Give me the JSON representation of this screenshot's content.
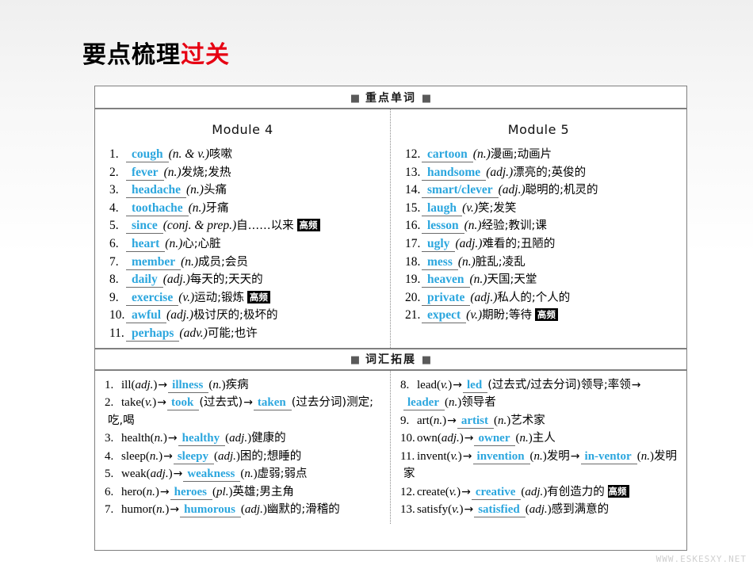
{
  "title": {
    "black": "要点梳理",
    "red": "过关",
    "red_color": "#e60012"
  },
  "accent_blue": "#2ba6de",
  "sections": {
    "key_words": {
      "band": "重点单词",
      "square": "■",
      "columns": [
        {
          "module": "Module 4",
          "items": [
            {
              "num": "1.",
              "word": "cough",
              "pos": "(n. & v.)",
              "meaning": "咳嗽",
              "badge": ""
            },
            {
              "num": "2.",
              "word": "fever",
              "pos": "(n.)",
              "meaning": "发烧;发热",
              "badge": ""
            },
            {
              "num": "3.",
              "word": "headache",
              "pos": "(n.)",
              "meaning": "头痛",
              "badge": ""
            },
            {
              "num": "4.",
              "word": "toothache",
              "pos": "(n.)",
              "meaning": "牙痛",
              "badge": ""
            },
            {
              "num": "5.",
              "word": "since",
              "pos": "(conj. & prep.)",
              "meaning": "自……以来",
              "badge": "高频"
            },
            {
              "num": "6.",
              "word": "heart",
              "pos": "(n.)",
              "meaning": "心;心脏",
              "badge": ""
            },
            {
              "num": "7.",
              "word": "member",
              "pos": "(n.)",
              "meaning": "成员;会员",
              "badge": ""
            },
            {
              "num": "8.",
              "word": "daily",
              "pos": "(adj.)",
              "meaning": "每天的;天天的",
              "badge": ""
            },
            {
              "num": "9.",
              "word": "exercise",
              "pos": "(v.)",
              "meaning": "运动;锻炼",
              "badge": "高频"
            },
            {
              "num": "10.",
              "word": "awful",
              "pos": "(adj.)",
              "meaning": "极讨厌的;极坏的",
              "badge": ""
            },
            {
              "num": "11.",
              "word": "perhaps",
              "pos": "(adv.)",
              "meaning": "可能;也许",
              "badge": ""
            }
          ]
        },
        {
          "module": "Module 5",
          "items": [
            {
              "num": "12.",
              "word": "cartoon",
              "pos": "(n.)",
              "meaning": "漫画;动画片",
              "badge": ""
            },
            {
              "num": "13.",
              "word": "handsome",
              "pos": "(adj.)",
              "meaning": "漂亮的;英俊的",
              "badge": ""
            },
            {
              "num": "14.",
              "word": "smart/clever",
              "pos": "(adj.)",
              "meaning": "聪明的;机灵的",
              "badge": ""
            },
            {
              "num": "15.",
              "word": "laugh",
              "pos": "(v.)",
              "meaning": "笑;发笑",
              "badge": ""
            },
            {
              "num": "16.",
              "word": "lesson",
              "pos": "(n.)",
              "meaning": "经验;教训;课",
              "badge": ""
            },
            {
              "num": "17.",
              "word": "ugly",
              "pos": "(adj.)",
              "meaning": "难看的;丑陋的",
              "badge": ""
            },
            {
              "num": "18.",
              "word": "mess",
              "pos": "(n.)",
              "meaning": "脏乱;凌乱",
              "badge": ""
            },
            {
              "num": "19.",
              "word": "heaven",
              "pos": "(n.)",
              "meaning": "天国;天堂",
              "badge": ""
            },
            {
              "num": "20.",
              "word": "private",
              "pos": "(adj.)",
              "meaning": "私人的;个人的",
              "badge": ""
            },
            {
              "num": "21.",
              "word": "expect",
              "pos": "(v.)",
              "meaning": "期盼;等待",
              "badge": "高频"
            }
          ]
        }
      ]
    },
    "word_expansion": {
      "band": "词汇拓展",
      "square": "■",
      "columns": [
        {
          "items": [
            {
              "num": "1.",
              "html": "ill(<i>adj.</i>)<span class=\"arr\">→</span><span class=\"blank\">illness</span>(<i>n.</i>)<span class=\"cn\">疾病</span>"
            },
            {
              "num": "2.",
              "html": "take(<i>v.</i>)<span class=\"arr\">→</span><span class=\"blank\">took</span><span class=\"cn\">(过去式)</span><span class=\"arr\">→</span><span class=\"blank\">taken</span><span class=\"cn\">(过去分词)测定;吃,喝</span>"
            },
            {
              "num": "3.",
              "html": "health(<i>n.</i>)<span class=\"arr\">→</span><span class=\"blank\">healthy</span>(<i>adj.</i>)<span class=\"cn\">健康的</span>"
            },
            {
              "num": "4.",
              "html": "sleep(<i>n.</i>)<span class=\"arr\">→</span><span class=\"blank\">sleepy</span>(<i>adj.</i>)<span class=\"cn\">困的;想睡的</span>"
            },
            {
              "num": "5.",
              "html": "weak(<i>adj.</i>)<span class=\"arr\">→</span><span class=\"blank\">weakness</span>(<i>n.</i>)<span class=\"cn\">虚弱;弱点</span>"
            },
            {
              "num": "6.",
              "html": "hero(<i>n.</i>)<span class=\"arr\">→</span><span class=\"blank\">heroes</span>(<i>pl.</i>)<span class=\"cn\">英雄;男主角</span>"
            },
            {
              "num": "7.",
              "html": "humor(<i>n.</i>)<span class=\"arr\">→</span><span class=\"blank\">humorous</span>(<i>adj.</i>)<span class=\"cn\">幽默的;滑稽的</span>"
            }
          ]
        },
        {
          "items": [
            {
              "num": "8.",
              "html": "lead(<i>v.</i>)<span class=\"arr\">→</span><span class=\"blank\">led</span><span class=\"cn\">(过去式/过去分词)领导;率领</span><span class=\"arr\">→</span><span class=\"blank\">leader</span>(<i>n.</i>)<span class=\"cn\">领导者</span>"
            },
            {
              "num": "9.",
              "html": "art(<i>n.</i>)<span class=\"arr\">→</span><span class=\"blank\">artist</span>(<i>n.</i>)<span class=\"cn\">艺术家</span>"
            },
            {
              "num": "10.",
              "html": "own(<i>adj.</i>)<span class=\"arr\">→</span><span class=\"blank\">owner</span>(<i>n.</i>)<span class=\"cn\">主人</span>"
            },
            {
              "num": "11.",
              "html": "invent(<i>v.</i>)<span class=\"arr\">→</span><span class=\"blank\">invention</span>(<i>n.</i>)<span class=\"cn\">发明</span><span class=\"arr\">→</span><span class=\"blank\">in-ventor</span>(<i>n.</i>)<span class=\"cn\">发明家</span>"
            },
            {
              "num": "12.",
              "html": "create(<i>v.</i>)<span class=\"arr\">→</span><span class=\"blank\">creative</span>(<i>adj.</i>)<span class=\"cn\">有创造力的</span> <span class=\"badge\">高频</span>"
            },
            {
              "num": "13.",
              "html": "satisfy(<i>v.</i>)<span class=\"arr\">→</span><span class=\"blank\">satisfied</span>(<i>adj.</i>)<span class=\"cn\">感到满意的</span>"
            }
          ]
        }
      ]
    }
  },
  "watermark": "WWW.ESKESXY.NET"
}
